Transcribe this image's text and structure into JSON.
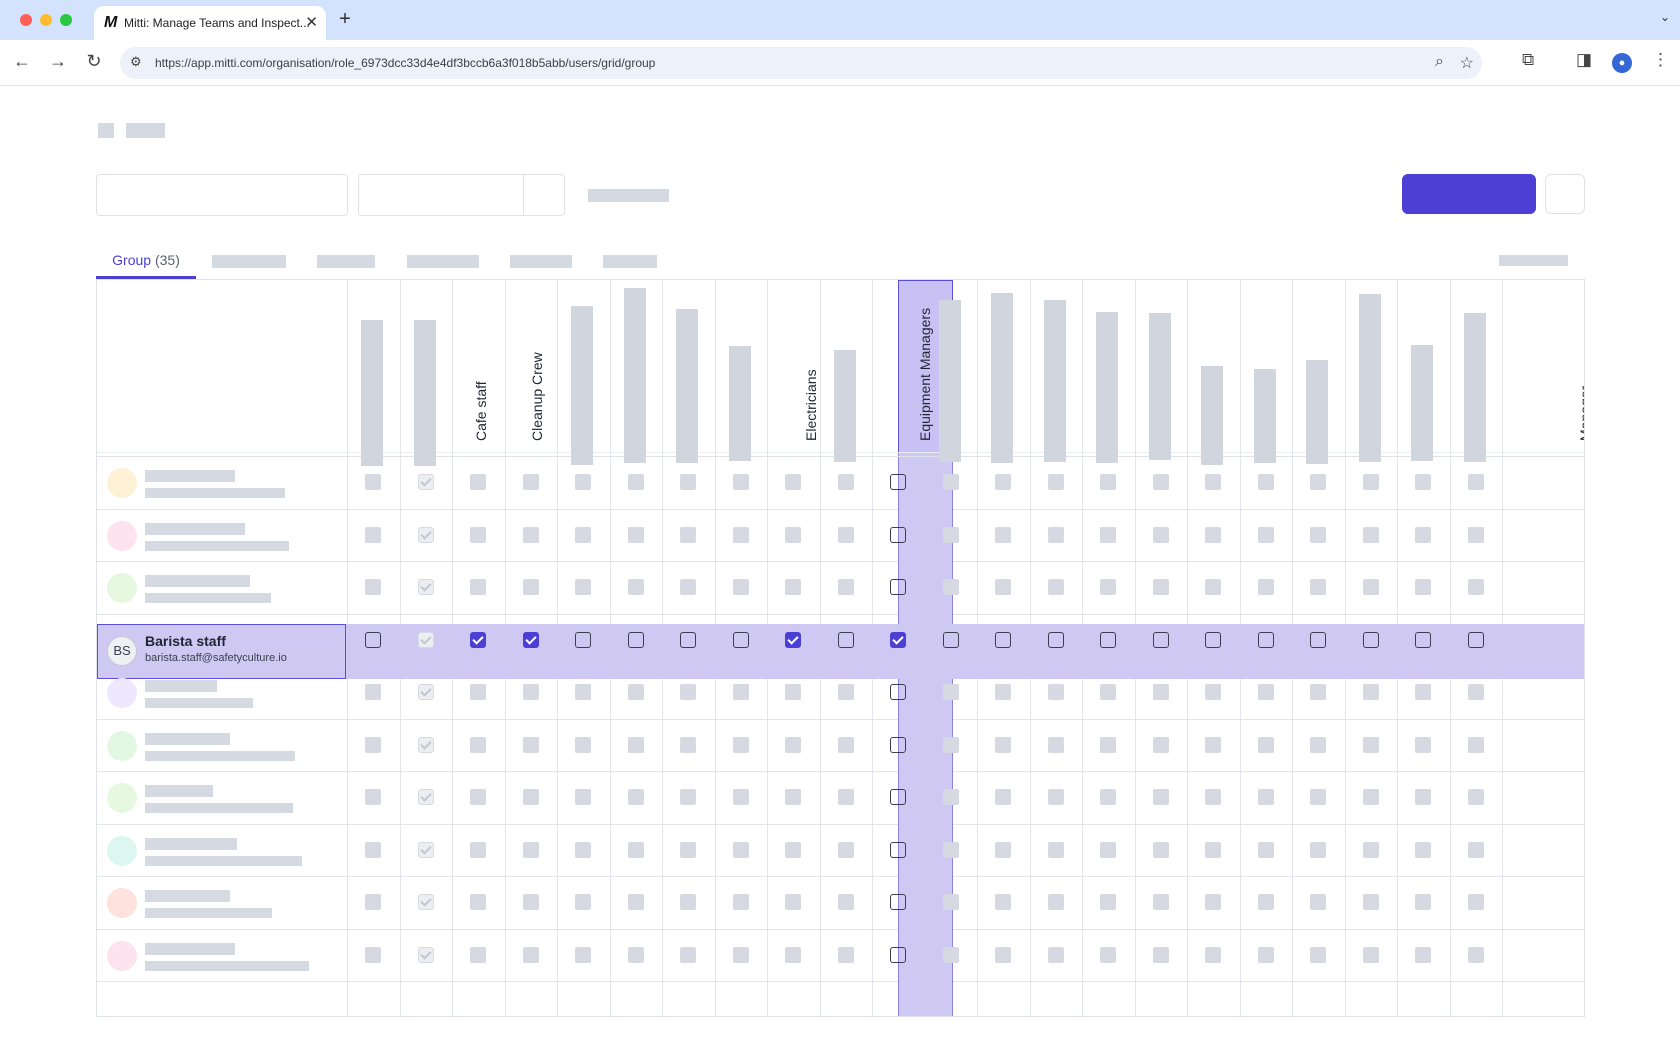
{
  "browser": {
    "tab_title": "Mitti: Manage Teams and Inspect...",
    "tab_logo": "M",
    "url": "https://app.mitti.com/organisation/role_6973dcc33d4e4df3bccb6a3f018b5abb/users/grid/group",
    "window_controls": {
      "close": "#ff5f57",
      "minimize": "#febc2e",
      "maximize": "#28c840"
    }
  },
  "tabs": {
    "active_label": "Group",
    "active_count": "(35)"
  },
  "grid": {
    "columns": {
      "cafe_staff": "Cafe staff",
      "cleanup_crew": "Cleanup Crew",
      "electricians": "Electricians",
      "equipment_managers": "Equipment Managers",
      "partial": "Managers"
    },
    "highlighted_user": {
      "initials": "BS",
      "name": "Barista staff",
      "email": "barista.staff@safetyculture.io"
    }
  },
  "colors": {
    "accent": "#4b3fd4",
    "highlight": "#cfc8f2"
  }
}
